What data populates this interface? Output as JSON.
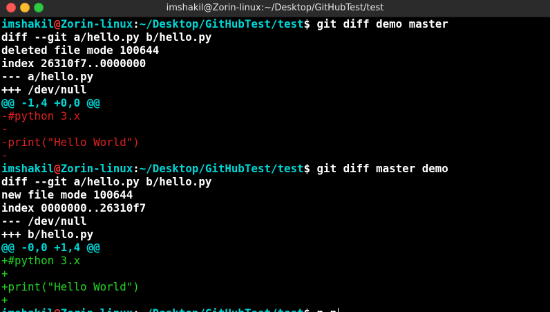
{
  "window": {
    "title": "imshakil@Zorin-linux:~/Desktop/GitHubTest/test"
  },
  "prompt": {
    "user": "imshakil",
    "at": "@",
    "host": "Zorin-linux",
    "sep": ":",
    "path": "~/Desktop/GitHubTest/test",
    "dollar": "$ "
  },
  "colors": {
    "prompt_user": "#00d7d7",
    "prompt_at": "#ff3b3b",
    "deleted_line": "#e02020",
    "added_line": "#22d822",
    "hunk_header": "#00d7d7"
  },
  "block1": {
    "command": "git diff demo master",
    "header": [
      "diff --git a/hello.py b/hello.py",
      "deleted file mode 100644",
      "index 26310f7..0000000",
      "--- a/hello.py",
      "+++ /dev/null"
    ],
    "hunk": "@@ -1,4 +0,0 @@",
    "lines": [
      "-#python 3.x",
      "-",
      "-print(\"Hello World\")",
      "-"
    ]
  },
  "block2": {
    "command": "git diff master demo",
    "header": [
      "diff --git a/hello.py b/hello.py",
      "new file mode 100644",
      "index 0000000..26310f7",
      "--- /dev/null",
      "+++ b/hello.py"
    ],
    "hunk": "@@ -0,0 +1,4 @@",
    "lines": [
      "+#python 3.x",
      "+",
      "+print(\"Hello World\")",
      "+"
    ]
  },
  "current_input": "p p"
}
